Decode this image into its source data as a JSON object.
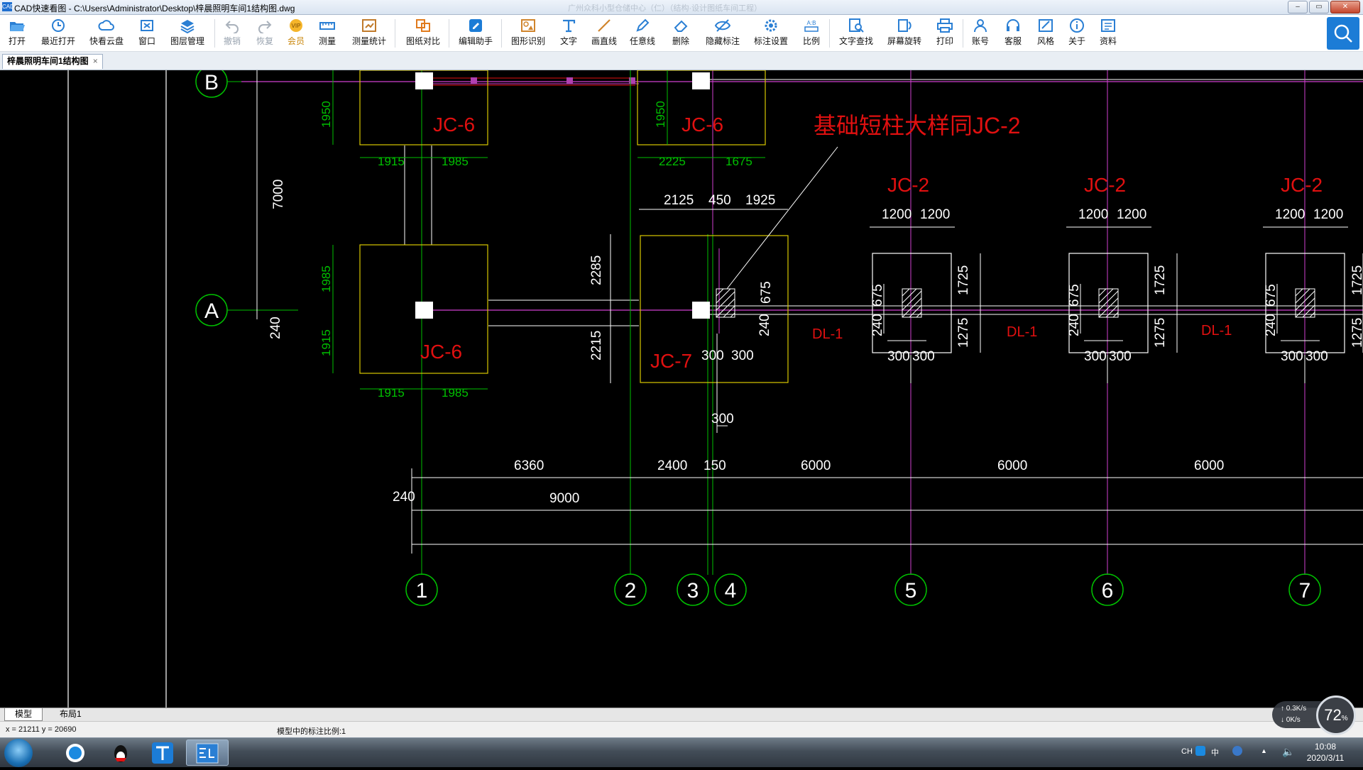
{
  "window": {
    "app_name": "CAD快速看图",
    "path": "C:\\Users\\Administrator\\Desktop\\梓晨照明车间1结构图.dwg",
    "faint_text": "广州众科小型仓储中心（仁）（结构·设计图纸车间工程）",
    "controls": {
      "minimize": "–",
      "maximize": "▭",
      "close": "✕"
    }
  },
  "toolbar": {
    "items": [
      {
        "id": "open",
        "label": "打开",
        "icon": "folder-open-icon"
      },
      {
        "id": "recent",
        "label": "最近打开",
        "icon": "clock-icon"
      },
      {
        "id": "cloud",
        "label": "快看云盘",
        "icon": "cloud-icon"
      },
      {
        "id": "window",
        "label": "窗口",
        "icon": "window-icon"
      },
      {
        "id": "layers",
        "label": "图层管理",
        "icon": "layers-icon"
      },
      {
        "id": "undo",
        "label": "撤销",
        "icon": "undo-icon"
      },
      {
        "id": "redo",
        "label": "恢复",
        "icon": "redo-icon"
      },
      {
        "id": "vip",
        "label": "会员",
        "icon": "vip-icon"
      },
      {
        "id": "measure",
        "label": "测量",
        "icon": "ruler-icon"
      },
      {
        "id": "measure-stats",
        "label": "测量统计",
        "icon": "measure-stats-icon"
      },
      {
        "id": "compare",
        "label": "图纸对比",
        "icon": "compare-icon"
      },
      {
        "id": "edit-assistant",
        "label": "编辑助手",
        "icon": "edit-assistant-icon"
      },
      {
        "id": "shape-recognition",
        "label": "图形识别",
        "icon": "shape-recognition-icon"
      },
      {
        "id": "text",
        "label": "文字",
        "icon": "text-icon"
      },
      {
        "id": "line",
        "label": "画直线",
        "icon": "line-icon"
      },
      {
        "id": "freehand",
        "label": "任意线",
        "icon": "pen-icon"
      },
      {
        "id": "delete",
        "label": "删除",
        "icon": "eraser-icon"
      },
      {
        "id": "hide-annotations",
        "label": "隐藏标注",
        "icon": "eye-hidden-icon"
      },
      {
        "id": "annotation-settings",
        "label": "标注设置",
        "icon": "annotation-settings-icon"
      },
      {
        "id": "scale",
        "label": "比例",
        "icon": "scale-icon"
      },
      {
        "id": "text-search",
        "label": "文字查找",
        "icon": "text-search-icon"
      },
      {
        "id": "rotate",
        "label": "屏幕旋转",
        "icon": "rotate-icon"
      },
      {
        "id": "print",
        "label": "打印",
        "icon": "printer-icon"
      },
      {
        "id": "account",
        "label": "账号",
        "icon": "user-icon"
      },
      {
        "id": "support",
        "label": "客服",
        "icon": "headset-icon"
      },
      {
        "id": "style",
        "label": "风格",
        "icon": "style-icon"
      },
      {
        "id": "about",
        "label": "关于",
        "icon": "info-icon"
      },
      {
        "id": "resources",
        "label": "资料",
        "icon": "resources-icon"
      }
    ],
    "accent": "#1c7cd6",
    "search_icon": "search-icon"
  },
  "tabs": {
    "active": "梓晨照明车间1结构图",
    "close": "×"
  },
  "drawing": {
    "axes": {
      "rows": [
        "B",
        "A"
      ],
      "cols": [
        "1",
        "2",
        "3",
        "4",
        "5",
        "6",
        "7"
      ]
    },
    "labels": {
      "jc6": "JC-6",
      "jc7": "JC-7",
      "jc2": "JC-2",
      "dl1": "DL-1",
      "note": "基础短柱大样同JC-2"
    },
    "dims": {
      "d1950": "1950",
      "d1915": "1915",
      "d1985": "1985",
      "d2225": "2225",
      "d1675": "1675",
      "d7000": "7000",
      "d240": "240",
      "d2125": "2125",
      "d450": "450",
      "d1925": "1925",
      "d2285": "2285",
      "d2215": "2215",
      "d675": "675",
      "d300": "300",
      "d1200": "1200",
      "d1725": "1725",
      "d1275": "1275",
      "d6360": "6360",
      "d2400": "2400",
      "d150": "150",
      "d6000": "6000",
      "d9000": "9000"
    },
    "colors": {
      "axis": "#00c000",
      "label": "#e01010",
      "dim": "#ffffff",
      "magenta": "#d040d0",
      "footing": "#d8c800"
    }
  },
  "layout_tabs": [
    "模型",
    "布局1"
  ],
  "status": {
    "coords": "x = 21211  y = 20690",
    "scale_text": "模型中的标注比例:1"
  },
  "net": {
    "up": "0.3K/s",
    "down": "0K/s",
    "percent": "72",
    "percent_unit": "%"
  },
  "tray": {
    "lang": "CH",
    "ime": "中",
    "time": "10:08",
    "date": "2020/3/11"
  }
}
